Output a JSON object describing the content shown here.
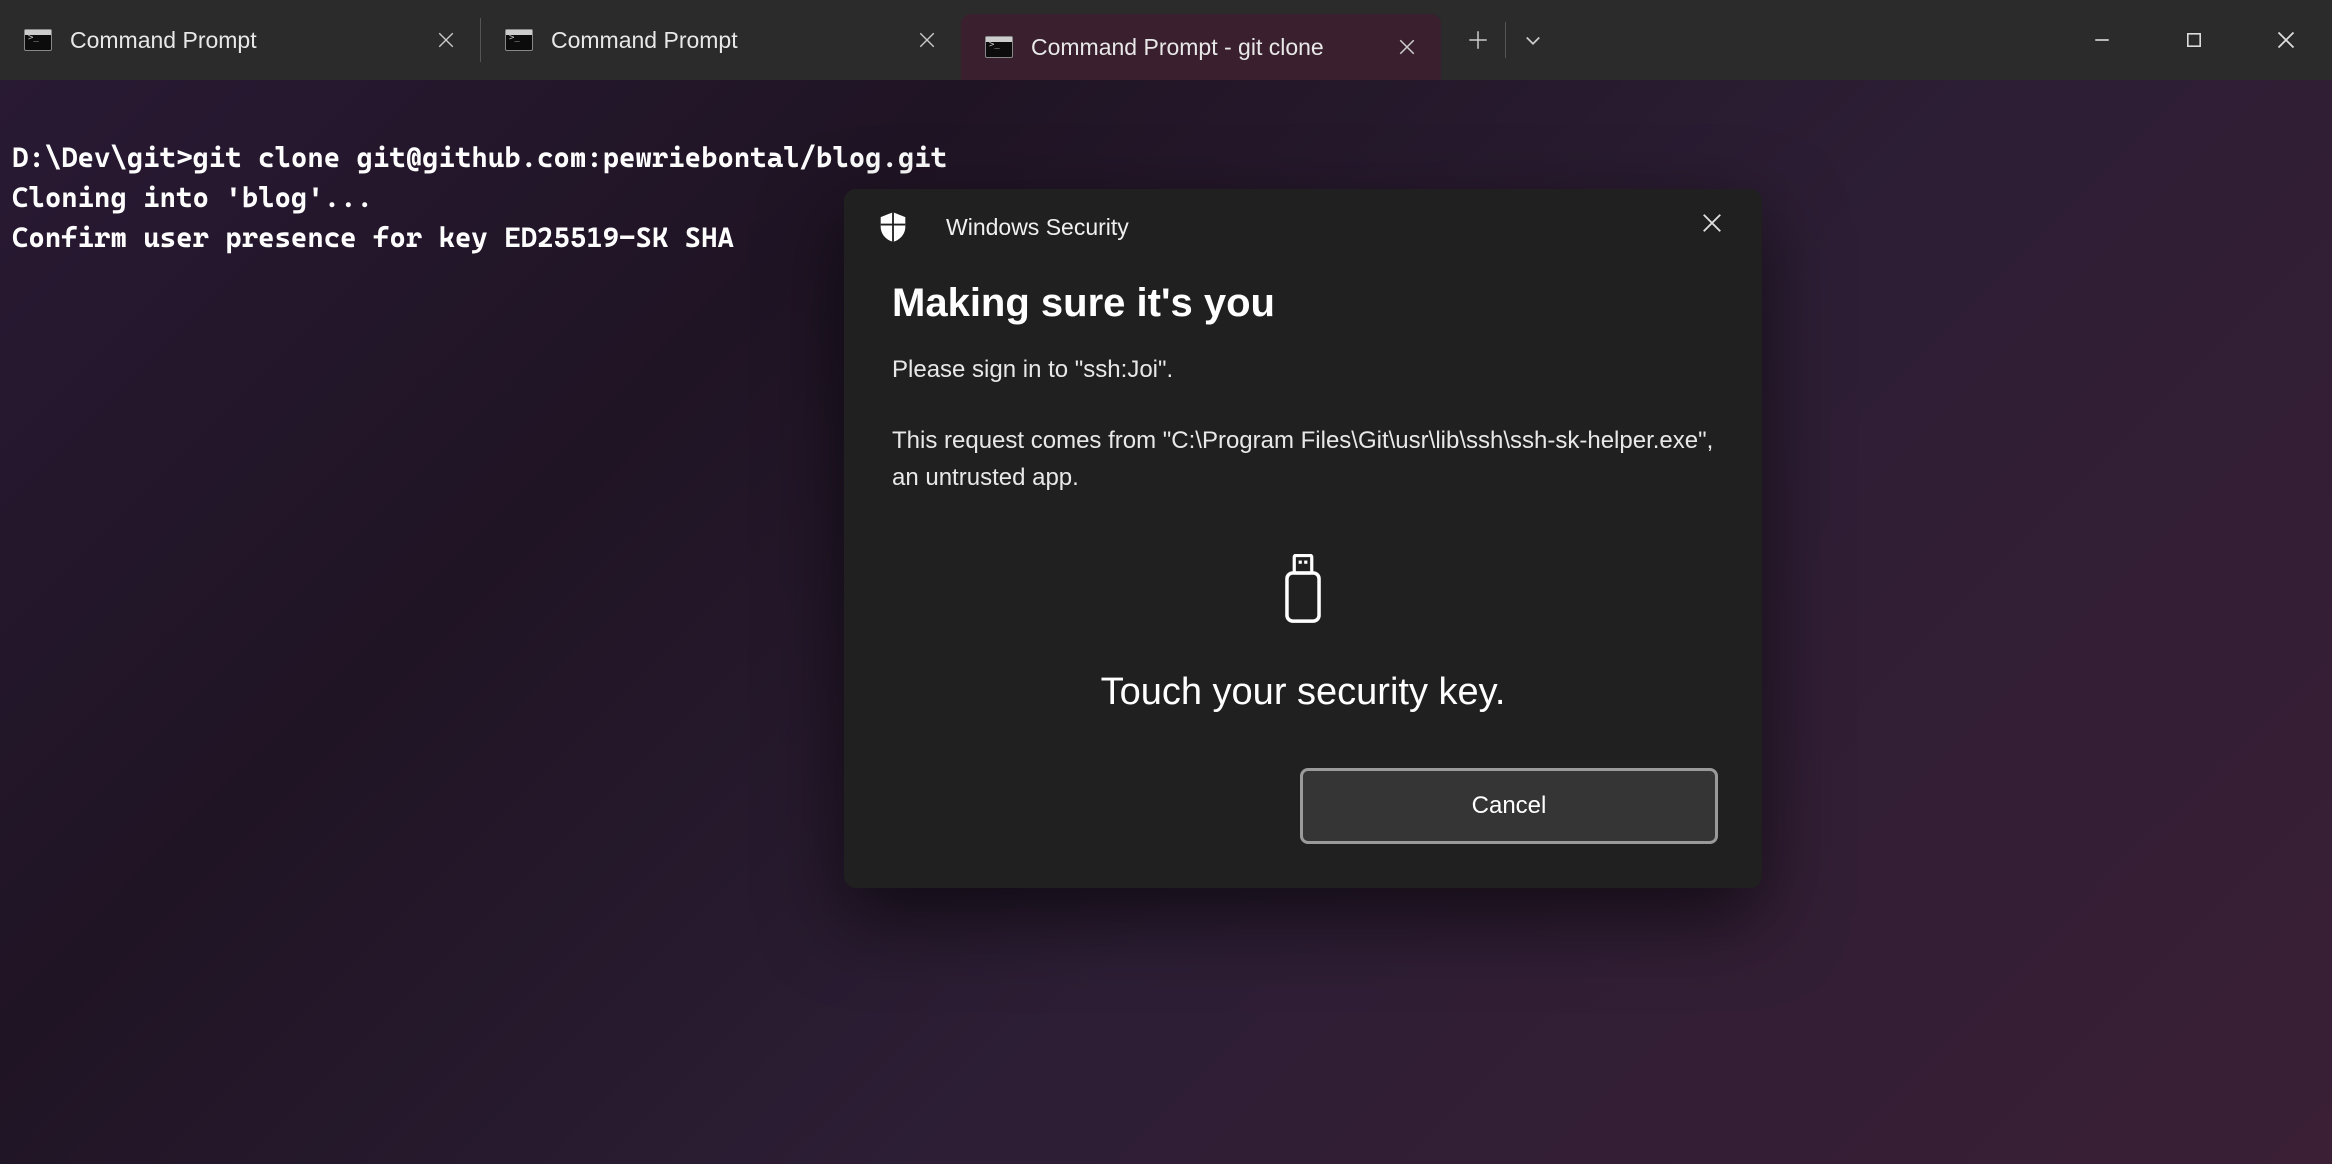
{
  "tabs": [
    {
      "title": "Command Prompt",
      "active": false
    },
    {
      "title": "Command Prompt",
      "active": false
    },
    {
      "title": "Command Prompt - git  clone",
      "active": true
    }
  ],
  "terminal": {
    "lines": [
      "D:\\Dev\\git>git clone git@github.com:pewriebontal/blog.git",
      "Cloning into 'blog'...",
      "Confirm user presence for key ED25519-SK SHA"
    ]
  },
  "dialog": {
    "app_name": "Windows Security",
    "title": "Making sure it's you",
    "subtitle": "Please sign in to \"ssh:Joi\".",
    "info": "This request comes from \"C:\\Program Files\\Git\\usr\\lib\\ssh\\ssh-sk-helper.exe\", an untrusted app.",
    "prompt": "Touch your security key.",
    "cancel_label": "Cancel"
  }
}
